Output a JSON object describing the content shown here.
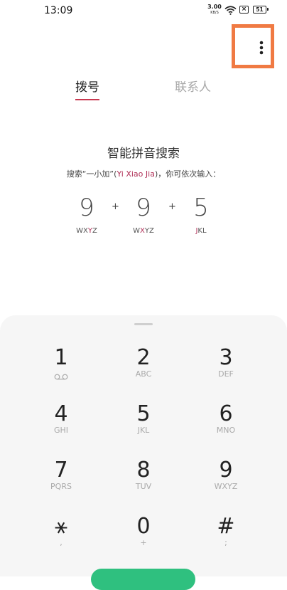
{
  "status_bar": {
    "time": "13:09",
    "net_speed_value": "3.00",
    "net_speed_unit": "KB/S",
    "battery_level": "51",
    "mute_symbol": "×",
    "icons": [
      "wifi-icon",
      "mute-icon",
      "battery-icon"
    ]
  },
  "header": {
    "more_icon": "more-vertical-icon",
    "highlight_color": "#f07a43"
  },
  "tabs": [
    {
      "label": "拨号",
      "active": true
    },
    {
      "label": "联系人",
      "active": false
    }
  ],
  "accent_color": "#c8384f",
  "hint": {
    "title": "智能拼音搜索",
    "subtitle_prefix": "搜索“一小加”(",
    "subtitle_y": "Y",
    "subtitle_i": "i ",
    "subtitle_x": "X",
    "subtitle_iao": "iao ",
    "subtitle_j": "J",
    "subtitle_ia": "ia",
    "subtitle_suffix": ")，你可依次输入：",
    "digits": [
      {
        "digit": "9",
        "letters_pre": "WX",
        "letters_hl": "Y",
        "letters_post": "Z"
      },
      {
        "digit": "9",
        "letters_pre": "W",
        "letters_hl": "X",
        "letters_post": "YZ"
      },
      {
        "digit": "5",
        "letters_pre": "",
        "letters_hl": "J",
        "letters_post": "KL"
      }
    ],
    "plus": "+"
  },
  "keypad": {
    "keys": [
      {
        "num": "1",
        "sub": "",
        "sub_icon": "voicemail-icon"
      },
      {
        "num": "2",
        "sub": "ABC"
      },
      {
        "num": "3",
        "sub": "DEF"
      },
      {
        "num": "4",
        "sub": "GHI"
      },
      {
        "num": "5",
        "sub": "JKL"
      },
      {
        "num": "6",
        "sub": "MNO"
      },
      {
        "num": "7",
        "sub": "PQRS"
      },
      {
        "num": "8",
        "sub": "TUV"
      },
      {
        "num": "9",
        "sub": "WXYZ"
      },
      {
        "num": "⚹",
        "sub": ","
      },
      {
        "num": "0",
        "sub": "+"
      },
      {
        "num": "#",
        "sub": ";"
      }
    ],
    "call_button_color": "#2fc07f"
  }
}
